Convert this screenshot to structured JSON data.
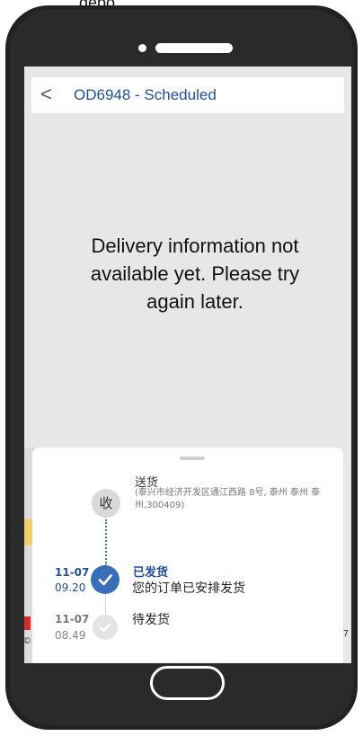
{
  "top_cut_text": "depo",
  "header": {
    "back_glyph": "<",
    "title": "OD6948 - Scheduled"
  },
  "message": "Delivery information not available yet. Please try again later.",
  "map": {
    "corner_text": "©",
    "right_text": "7"
  },
  "timeline": {
    "receive": {
      "badge": "收",
      "title": "送货",
      "address": "(泰兴市经济开发区通江西路 8号, 泰州 泰州 泰州,300409)"
    },
    "shipped": {
      "date": "11-07",
      "time": "09.20",
      "title": "已发货",
      "desc": "您的订单已安排发货"
    },
    "pending": {
      "date": "11-07",
      "time": "08.49",
      "title": "待发货"
    }
  },
  "colors": {
    "accent": "#1f4e99",
    "phone_body": "#222222",
    "screen_bg": "#e7e7e7"
  }
}
